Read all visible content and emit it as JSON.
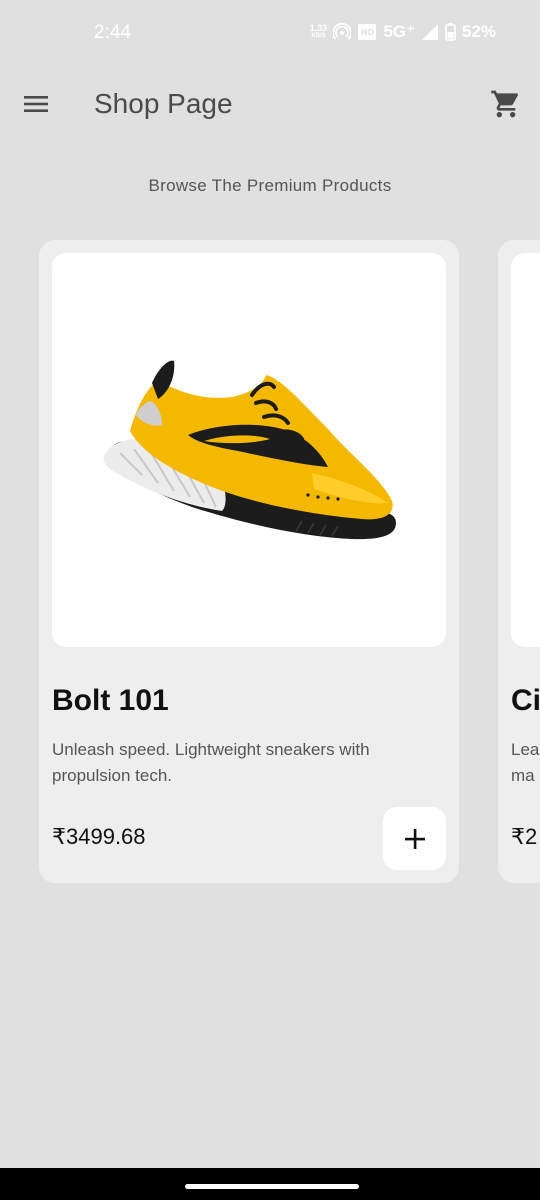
{
  "status_bar": {
    "time": "2:44",
    "net_speed_value": "1.33",
    "net_speed_unit": "KB/S",
    "network": "5G⁺",
    "battery": "52%"
  },
  "app_bar": {
    "title": "Shop Page",
    "menu_icon": "hamburger-menu-icon",
    "cart_icon": "shopping-cart-icon"
  },
  "subtitle": "Browse The Premium Products",
  "products": [
    {
      "name": "Bolt 101",
      "description": "Unleash speed. Lightweight sneakers with propulsion tech.",
      "price": "₹3499.68",
      "add_label": "+"
    },
    {
      "name": "Ci",
      "description": "Lea ma",
      "price": "₹2",
      "add_label": "+"
    }
  ],
  "colors": {
    "background": "#e0e0e0",
    "card": "#eeeeee",
    "image_bg": "#ffffff",
    "shoe_yellow": "#f5b800",
    "shoe_black": "#1c1c1c"
  }
}
